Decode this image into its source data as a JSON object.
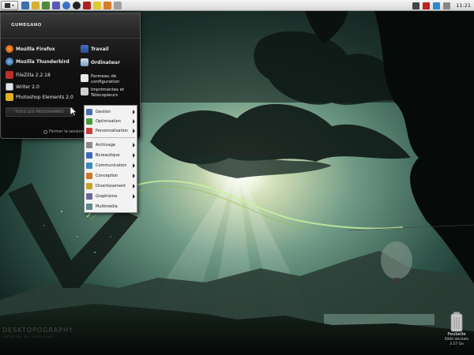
{
  "panel": {
    "clock": "11:21"
  },
  "main_menu": {
    "username": "GUMEGANO",
    "apps": [
      {
        "label": "Mozilla Firefox",
        "icon": "firefox-icon"
      },
      {
        "label": "Mozilla Thunderbird",
        "icon": "thunderbird-icon"
      },
      {
        "label": "FileZilla 2.2.18",
        "icon": "filezilla-icon"
      },
      {
        "label": "Writer 2.0",
        "icon": "writer-icon"
      },
      {
        "label": "Photoshop Elements 2.0",
        "icon": "photoshop-icon"
      }
    ],
    "places": [
      {
        "label": "Travail",
        "icon": "folder-icon"
      },
      {
        "label": "Ordinateur",
        "icon": "computer-icon"
      },
      {
        "label": "Panneau de configuration",
        "icon": "control-panel-icon"
      },
      {
        "label": "Imprimantes et Télécopieurs",
        "icon": "printer-icon"
      }
    ],
    "all_programs": "TOUS LES PROGRAMMES",
    "logout": "Fermer la session"
  },
  "submenu": {
    "items": [
      {
        "label": "Gestion",
        "color": "#4a6fa8"
      },
      {
        "label": "Optimisation",
        "color": "#4a9a3a"
      },
      {
        "label": "Personnalisation",
        "color": "#c84040"
      },
      {
        "label": "Archivage",
        "color": "#8a8a8a"
      },
      {
        "label": "Bureautique",
        "color": "#3a6ab8"
      },
      {
        "label": "Communication",
        "color": "#3a8ab8"
      },
      {
        "label": "Conception",
        "color": "#c87a2a"
      },
      {
        "label": "Divertissement",
        "color": "#c8a02a"
      },
      {
        "label": "Graphisme",
        "color": "#6a6a9a"
      },
      {
        "label": "Multimédia",
        "color": "#5a8a8a"
      }
    ]
  },
  "trash": {
    "label": "Poubelle",
    "items": "5000 déchets",
    "size": "3.57 Go"
  },
  "wallpaper": {
    "brand": "DESKTOPOGRAPHY",
    "brand_sub": "ARTWORK BY GUMEGANO"
  }
}
